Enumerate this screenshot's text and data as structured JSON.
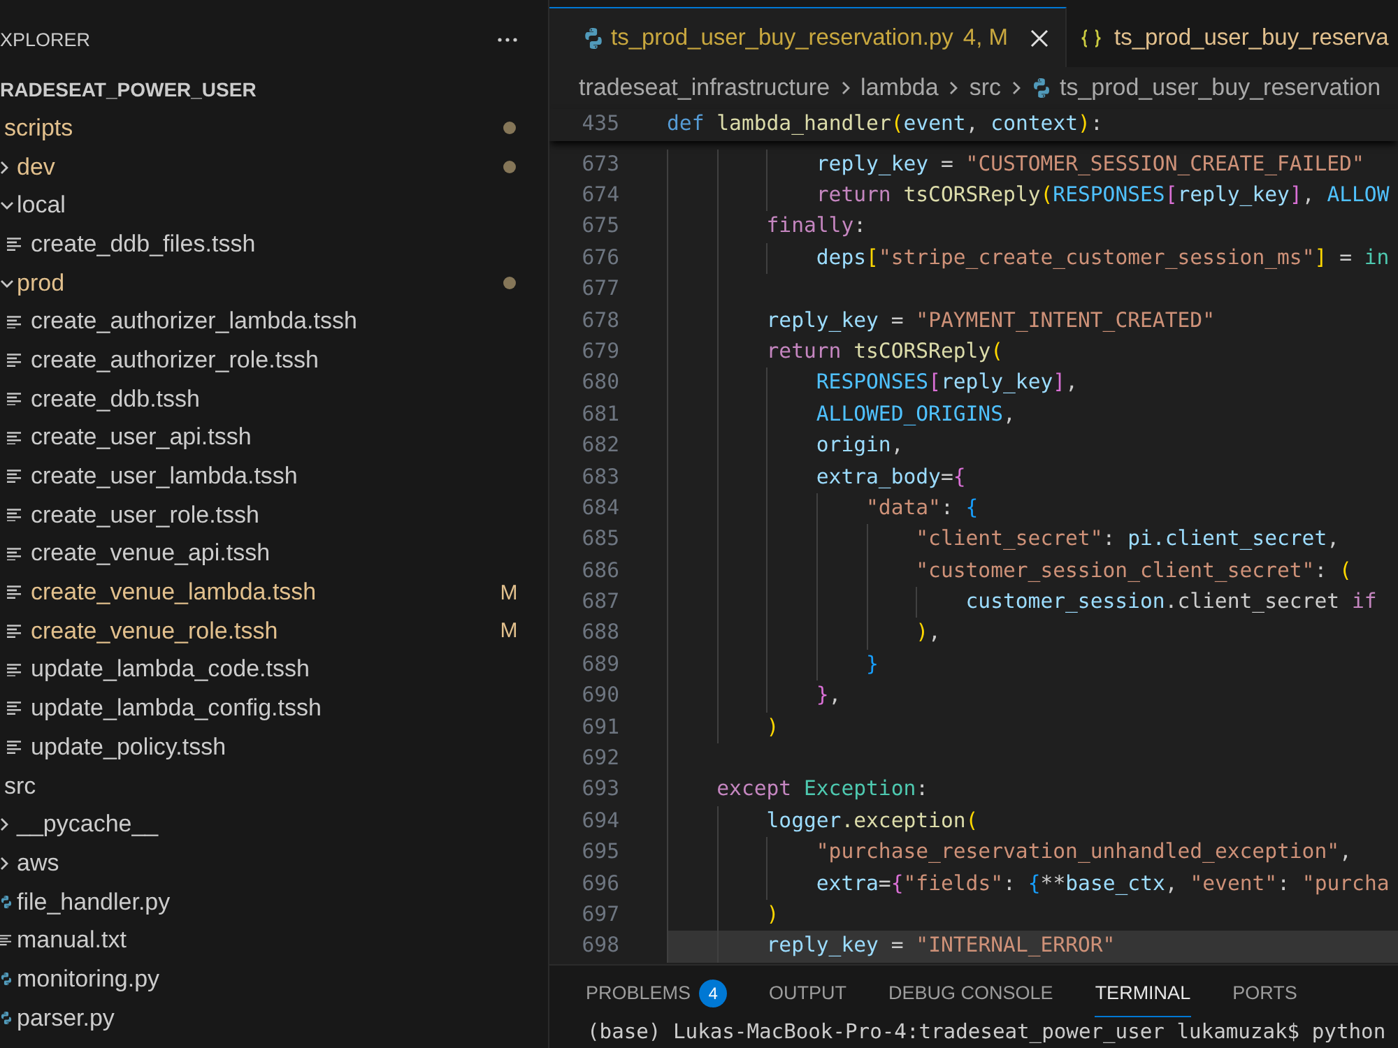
{
  "explorer": {
    "title": "XPLORER",
    "root": "RADESEAT_POWER_USER",
    "items": [
      {
        "name": "scripts",
        "kind": "folder",
        "modified": true,
        "children": [
          {
            "name": "dev",
            "kind": "folder",
            "expanded": false,
            "modified": true
          },
          {
            "name": "local",
            "kind": "folder",
            "expanded": true,
            "modified": false,
            "children": [
              {
                "name": "create_ddb_files.tssh",
                "kind": "document",
                "modified": false
              }
            ]
          },
          {
            "name": "prod",
            "kind": "folder",
            "expanded": true,
            "modified": true,
            "children": [
              {
                "name": "create_authorizer_lambda.tssh",
                "kind": "document",
                "modified": false
              },
              {
                "name": "create_authorizer_role.tssh",
                "kind": "document",
                "modified": false
              },
              {
                "name": "create_ddb.tssh",
                "kind": "document",
                "modified": false
              },
              {
                "name": "create_user_api.tssh",
                "kind": "document",
                "modified": false
              },
              {
                "name": "create_user_lambda.tssh",
                "kind": "document",
                "modified": false
              },
              {
                "name": "create_user_role.tssh",
                "kind": "document",
                "modified": false
              },
              {
                "name": "create_venue_api.tssh",
                "kind": "document",
                "modified": false
              },
              {
                "name": "create_venue_lambda.tssh",
                "kind": "document",
                "modified": true,
                "badge": "M"
              },
              {
                "name": "create_venue_role.tssh",
                "kind": "document",
                "modified": true,
                "badge": "M"
              },
              {
                "name": "update_lambda_code.tssh",
                "kind": "document",
                "modified": false
              },
              {
                "name": "update_lambda_config.tssh",
                "kind": "document",
                "modified": false
              },
              {
                "name": "update_policy.tssh",
                "kind": "document",
                "modified": false
              }
            ]
          }
        ]
      },
      {
        "name": "src",
        "kind": "folder",
        "modified": false,
        "children": [
          {
            "name": "__pycache__",
            "kind": "folder",
            "expanded": false,
            "modified": false
          },
          {
            "name": "aws",
            "kind": "folder",
            "expanded": false,
            "modified": false
          },
          {
            "name": "file_handler.py",
            "kind": "python",
            "modified": false
          },
          {
            "name": "manual.txt",
            "kind": "document",
            "modified": false
          },
          {
            "name": "monitoring.py",
            "kind": "python",
            "modified": false
          },
          {
            "name": "parser.py",
            "kind": "python",
            "modified": false
          }
        ]
      }
    ]
  },
  "tabs": [
    {
      "label": "ts_prod_user_buy_reservation.py",
      "status": "4, M",
      "kind": "python",
      "warnings": true,
      "selected": true
    },
    {
      "label": "ts_prod_user_buy_reserva",
      "kind": "json",
      "warnings": false,
      "modified": true,
      "selected": false
    }
  ],
  "breadcrumbs": [
    {
      "label": "tradeseat_infrastructure",
      "kind": "folder"
    },
    {
      "label": "lambda",
      "kind": "folder"
    },
    {
      "label": "src",
      "kind": "folder"
    },
    {
      "label": "ts_prod_user_buy_reservation",
      "kind": "python"
    }
  ],
  "editor": {
    "sticky_line": {
      "number": "435",
      "tokens": [
        {
          "kind": "storage",
          "text": "def "
        },
        {
          "kind": "function",
          "text": "lambda_handler"
        },
        {
          "kind": "bracket1",
          "text": "("
        },
        {
          "kind": "variable",
          "text": "event"
        },
        {
          "kind": "plain",
          "text": ", "
        },
        {
          "kind": "variable",
          "text": "context"
        },
        {
          "kind": "bracket1",
          "text": ")"
        },
        {
          "kind": "plain",
          "text": ":"
        }
      ]
    },
    "lines": [
      {
        "number": "673",
        "current": false,
        "tokens": [
          {
            "kind": "variable",
            "text": "            reply_key"
          },
          {
            "kind": "plain",
            "text": " = "
          },
          {
            "kind": "string",
            "text": "\"CUSTOMER_SESSION_CREATE_FAILED\""
          }
        ]
      },
      {
        "number": "674",
        "current": false,
        "tokens": [
          {
            "kind": "keyword",
            "text": "            return "
          },
          {
            "kind": "function",
            "text": "tsCORSReply"
          },
          {
            "kind": "bracket1",
            "text": "("
          },
          {
            "kind": "constant",
            "text": "RESPONSES"
          },
          {
            "kind": "bracket2",
            "text": "["
          },
          {
            "kind": "variable",
            "text": "reply_key"
          },
          {
            "kind": "bracket2",
            "text": "]"
          },
          {
            "kind": "plain",
            "text": ", "
          },
          {
            "kind": "constant",
            "text": "ALLOW"
          }
        ]
      },
      {
        "number": "675",
        "current": false,
        "tokens": [
          {
            "kind": "keyword",
            "text": "        finally"
          },
          {
            "kind": "plain",
            "text": ":"
          }
        ]
      },
      {
        "number": "676",
        "current": false,
        "tokens": [
          {
            "kind": "variable",
            "text": "            deps"
          },
          {
            "kind": "bracket1",
            "text": "["
          },
          {
            "kind": "string",
            "text": "\"stripe_create_customer_session_ms\""
          },
          {
            "kind": "bracket1",
            "text": "]"
          },
          {
            "kind": "plain",
            "text": " = "
          },
          {
            "kind": "class",
            "text": "in"
          }
        ]
      },
      {
        "number": "677",
        "current": false
      },
      {
        "number": "678",
        "current": false,
        "tokens": [
          {
            "kind": "variable",
            "text": "        reply_key"
          },
          {
            "kind": "plain",
            "text": " = "
          },
          {
            "kind": "string",
            "text": "\"PAYMENT_INTENT_CREATED\""
          }
        ]
      },
      {
        "number": "679",
        "current": false,
        "tokens": [
          {
            "kind": "keyword",
            "text": "        return "
          },
          {
            "kind": "function",
            "text": "tsCORSReply"
          },
          {
            "kind": "bracket1",
            "text": "("
          }
        ]
      },
      {
        "number": "680",
        "current": false,
        "tokens": [
          {
            "kind": "constant",
            "text": "            RESPONSES"
          },
          {
            "kind": "bracket2",
            "text": "["
          },
          {
            "kind": "variable",
            "text": "reply_key"
          },
          {
            "kind": "bracket2",
            "text": "]"
          },
          {
            "kind": "plain",
            "text": ","
          }
        ]
      },
      {
        "number": "681",
        "current": false,
        "tokens": [
          {
            "kind": "constant",
            "text": "            ALLOWED_ORIGINS"
          },
          {
            "kind": "plain",
            "text": ","
          }
        ]
      },
      {
        "number": "682",
        "current": false,
        "tokens": [
          {
            "kind": "variable",
            "text": "            origin"
          },
          {
            "kind": "plain",
            "text": ","
          }
        ]
      },
      {
        "number": "683",
        "current": false,
        "tokens": [
          {
            "kind": "variable",
            "text": "            extra_body"
          },
          {
            "kind": "plain",
            "text": "="
          },
          {
            "kind": "bracket2",
            "text": "{"
          }
        ]
      },
      {
        "number": "684",
        "current": false,
        "tokens": [
          {
            "kind": "string",
            "text": "                \"data\""
          },
          {
            "kind": "plain",
            "text": ": "
          },
          {
            "kind": "bracket3",
            "text": "{"
          }
        ]
      },
      {
        "number": "685",
        "current": false,
        "tokens": [
          {
            "kind": "string",
            "text": "                    \"client_secret\""
          },
          {
            "kind": "plain",
            "text": ": "
          },
          {
            "kind": "variable",
            "text": "pi.client_secret"
          },
          {
            "kind": "plain",
            "text": ","
          }
        ]
      },
      {
        "number": "686",
        "current": false,
        "tokens": [
          {
            "kind": "string",
            "text": "                    \"customer_session_client_secret\""
          },
          {
            "kind": "plain",
            "text": ": "
          },
          {
            "kind": "bracket1",
            "text": "("
          }
        ]
      },
      {
        "number": "687",
        "current": false,
        "tokens": [
          {
            "kind": "variable",
            "text": "                        customer_session"
          },
          {
            "kind": "plain",
            "text": ".client_secret "
          },
          {
            "kind": "keyword",
            "text": "if"
          }
        ]
      },
      {
        "number": "688",
        "current": false,
        "tokens": [
          {
            "kind": "bracket1",
            "text": "                    )"
          },
          {
            "kind": "plain",
            "text": ","
          }
        ]
      },
      {
        "number": "689",
        "current": false,
        "tokens": [
          {
            "kind": "bracket3",
            "text": "                }"
          }
        ]
      },
      {
        "number": "690",
        "current": false,
        "tokens": [
          {
            "kind": "bracket2",
            "text": "            }"
          },
          {
            "kind": "plain",
            "text": ","
          }
        ]
      },
      {
        "number": "691",
        "current": false,
        "tokens": [
          {
            "kind": "bracket1",
            "text": "        )"
          }
        ]
      },
      {
        "number": "692",
        "current": false
      },
      {
        "number": "693",
        "current": false,
        "tokens": [
          {
            "kind": "keyword",
            "text": "    except "
          },
          {
            "kind": "class",
            "text": "Exception"
          },
          {
            "kind": "plain",
            "text": ":"
          }
        ]
      },
      {
        "number": "694",
        "current": false,
        "tokens": [
          {
            "kind": "variable",
            "text": "        logger"
          },
          {
            "kind": "function",
            "text": ".exception"
          },
          {
            "kind": "bracket1",
            "text": "("
          }
        ]
      },
      {
        "number": "695",
        "current": false,
        "tokens": [
          {
            "kind": "string",
            "text": "            \"purchase_reservation_unhandled_exception\""
          },
          {
            "kind": "plain",
            "text": ","
          }
        ]
      },
      {
        "number": "696",
        "current": false,
        "tokens": [
          {
            "kind": "variable",
            "text": "            extra"
          },
          {
            "kind": "plain",
            "text": "="
          },
          {
            "kind": "bracket2",
            "text": "{"
          },
          {
            "kind": "string",
            "text": "\"fields\""
          },
          {
            "kind": "plain",
            "text": ": "
          },
          {
            "kind": "bracket3",
            "text": "{"
          },
          {
            "kind": "plain",
            "text": "**"
          },
          {
            "kind": "variable",
            "text": "base_ctx"
          },
          {
            "kind": "plain",
            "text": ", "
          },
          {
            "kind": "string",
            "text": "\"event\""
          },
          {
            "kind": "plain",
            "text": ": "
          },
          {
            "kind": "string",
            "text": "\"purcha"
          }
        ]
      },
      {
        "number": "697",
        "current": false,
        "tokens": [
          {
            "kind": "bracket1",
            "text": "        )"
          }
        ]
      },
      {
        "number": "698",
        "current": true,
        "tokens": [
          {
            "kind": "variable",
            "text": "        reply_key"
          },
          {
            "kind": "plain",
            "text": " = "
          },
          {
            "kind": "string",
            "text": "\"INTERNAL_ERROR\""
          }
        ]
      }
    ]
  },
  "panel": {
    "tabs": [
      {
        "label": "PROBLEMS",
        "badge": "4",
        "selected": false
      },
      {
        "label": "OUTPUT",
        "selected": false
      },
      {
        "label": "DEBUG CONSOLE",
        "selected": false
      },
      {
        "label": "TERMINAL",
        "selected": true
      },
      {
        "label": "PORTS",
        "selected": false
      }
    ],
    "terminal_lines": [
      "(base) Lukas-MacBook-Pro-4:tradeseat_power_user lukamuzak$ python"
    ]
  }
}
